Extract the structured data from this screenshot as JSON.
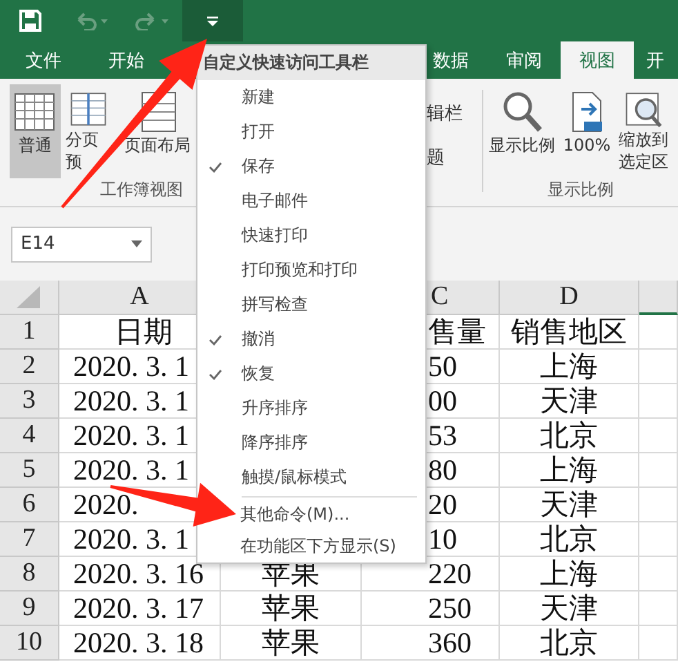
{
  "tabs_left": [
    {
      "label": "文件",
      "selected": false
    },
    {
      "label": "开始",
      "selected": false
    }
  ],
  "tabs_right": [
    {
      "label": "数据",
      "selected": false
    },
    {
      "label": "审阅",
      "selected": false
    },
    {
      "label": "视图",
      "selected": true
    },
    {
      "label": "开",
      "selected": false
    }
  ],
  "ribbon": {
    "view_group": {
      "buttons": [
        {
          "kind": "normal",
          "lines": [
            "普通"
          ],
          "selected": true
        },
        {
          "kind": "pagebreak",
          "lines": [
            "分页",
            "预"
          ],
          "selected": false
        },
        {
          "kind": "layout",
          "lines": [
            "页面布局"
          ],
          "selected": false
        }
      ],
      "label": "工作簿视图"
    },
    "show_partial": [
      "辑栏",
      "题"
    ],
    "zoom_group": {
      "buttons": [
        {
          "kind": "zoom",
          "lines": [
            "显示比例"
          ]
        },
        {
          "kind": "hundred",
          "lines": [
            "100%"
          ]
        },
        {
          "kind": "selection",
          "lines": [
            "缩放到",
            "选定区"
          ]
        }
      ],
      "label": "显示比例"
    }
  },
  "name_box": "E14",
  "columns": [
    "A",
    "C",
    "D"
  ],
  "rows": [
    {
      "n": "1",
      "a": "日期",
      "c": "售量",
      "d": "销售地区"
    },
    {
      "n": "2",
      "a": "2020. 3. 1",
      "c": "50",
      "d": "上海"
    },
    {
      "n": "3",
      "a": "2020. 3. 1",
      "c": "00",
      "d": "天津"
    },
    {
      "n": "4",
      "a": "2020. 3. 1",
      "c": "53",
      "d": "北京"
    },
    {
      "n": "5",
      "a": "2020. 3. 1",
      "c": "80",
      "d": "上海"
    },
    {
      "n": "6",
      "a": "2020.",
      "c": "20",
      "d": "天津"
    },
    {
      "n": "7",
      "a": "2020. 3. 1",
      "c": "10",
      "d": "北京"
    },
    {
      "n": "8",
      "a": "2020. 3. 16",
      "b": "苹果",
      "c": "220",
      "d": "上海"
    },
    {
      "n": "9",
      "a": "2020. 3. 17",
      "b": "苹果",
      "c": "250",
      "d": "天津"
    },
    {
      "n": "10",
      "a": "2020. 3. 18",
      "b": "苹果",
      "c": "360",
      "d": "北京"
    }
  ],
  "menu": {
    "title": "自定义快速访问工具栏",
    "items": [
      {
        "label": "新建",
        "checked": false
      },
      {
        "label": "打开",
        "checked": false
      },
      {
        "label": "保存",
        "checked": true
      },
      {
        "label": "电子邮件",
        "checked": false
      },
      {
        "label": "快速打印",
        "checked": false
      },
      {
        "label": "打印预览和打印",
        "checked": false
      },
      {
        "label": "拼写检查",
        "checked": false
      },
      {
        "label": "撤消",
        "checked": true
      },
      {
        "label": "恢复",
        "checked": true
      },
      {
        "label": "升序排序",
        "checked": false
      },
      {
        "label": "降序排序",
        "checked": false
      },
      {
        "label": "触摸/鼠标模式",
        "checked": false
      }
    ],
    "footer_items": [
      "其他命令(M)...",
      "在功能区下方显示(S)"
    ]
  }
}
